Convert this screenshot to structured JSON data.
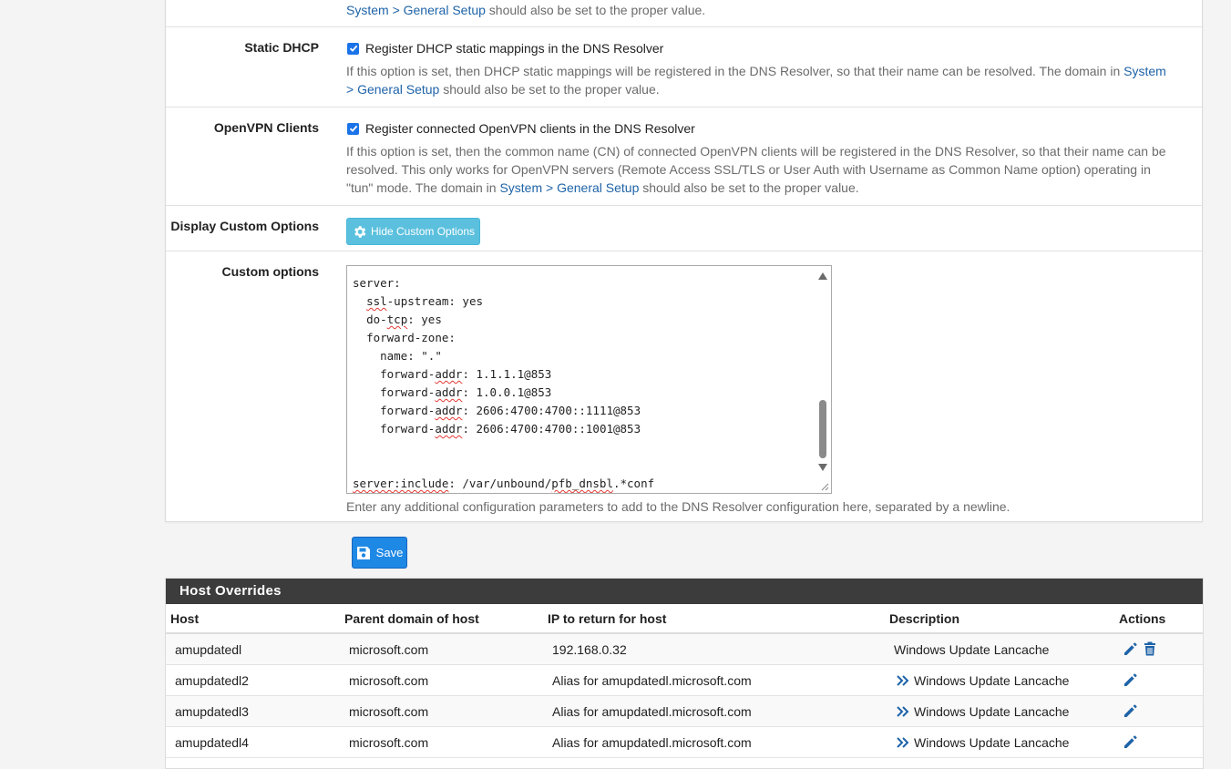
{
  "sections": {
    "top_note": {
      "link": "System > General Setup",
      "text": " should also be set to the proper value."
    },
    "static_dhcp": {
      "label": "Static DHCP",
      "checkbox_label": "Register DHCP static mappings in the DNS Resolver",
      "checked": true,
      "help_prefix": "If this option is set, then DHCP static mappings will be registered in the DNS Resolver, so that their name can be resolved. The domain in ",
      "help_link": "System > General Setup",
      "help_suffix": " should also be set to the proper value."
    },
    "openvpn_clients": {
      "label": "OpenVPN Clients",
      "checkbox_label": "Register connected OpenVPN clients in the DNS Resolver",
      "checked": true,
      "help_prefix": "If this option is set, then the common name (CN) of connected OpenVPN clients will be registered in the DNS Resolver, so that their name can be resolved. This only works for OpenVPN servers (Remote Access SSL/TLS or User Auth with Username as Common Name option) operating in \"tun\" mode. The domain in ",
      "help_link": "System > General Setup",
      "help_suffix": " should also be set to the proper value."
    },
    "display_custom": {
      "label": "Display Custom Options",
      "button_label": "Hide Custom Options",
      "button_icon": "gear-icon"
    },
    "custom_options": {
      "label": "Custom options",
      "help": "Enter any additional configuration parameters to add to the DNS Resolver configuration here, separated by a newline."
    }
  },
  "code": {
    "l1": "server:",
    "l2a": "ssl",
    "l2b": "-upstream: yes",
    "l3a": "do-",
    "l3b": "tcp",
    "l3c": ": yes",
    "l4": "forward-zone:",
    "l5": "name: \".\"",
    "l6a": "forward-",
    "l6b": "addr",
    "l6c": ": 1.1.1.1@853",
    "l7a": "forward-",
    "l7b": "addr",
    "l7c": ": 1.0.0.1@853",
    "l8a": "forward-",
    "l8b": "addr",
    "l8c": ": 2606:4700:4700::1111@853",
    "l9a": "forward-",
    "l9b": "addr",
    "l9c": ": 2606:4700:4700::1001@853",
    "l10a": "server:include",
    "l10b": ": /var/unbound/",
    "l10c": "pfb_dnsbl",
    "l10d": ".*conf"
  },
  "save": {
    "label": "Save",
    "icon": "floppy-disk-icon"
  },
  "host_overrides": {
    "title": "Host Overrides",
    "columns": [
      "Host",
      "Parent domain of host",
      "IP to return for host",
      "Description",
      "Actions"
    ],
    "rows": [
      {
        "host": "amupdatedl",
        "domain": "microsoft.com",
        "ip": "192.168.0.32",
        "description": "Windows Update Lancache",
        "alias": false,
        "actions": [
          "edit-icon",
          "delete-icon"
        ]
      },
      {
        "host": "amupdatedl2",
        "domain": "microsoft.com",
        "ip": "Alias for amupdatedl.microsoft.com",
        "description": "Windows Update Lancache",
        "alias": true,
        "actions": [
          "edit-icon"
        ]
      },
      {
        "host": "amupdatedl3",
        "domain": "microsoft.com",
        "ip": "Alias for amupdatedl.microsoft.com",
        "description": "Windows Update Lancache",
        "alias": true,
        "actions": [
          "edit-icon"
        ]
      },
      {
        "host": "amupdatedl4",
        "domain": "microsoft.com",
        "ip": "Alias for amupdatedl.microsoft.com",
        "description": "Windows Update Lancache",
        "alias": true,
        "actions": [
          "edit-icon"
        ]
      }
    ]
  },
  "colors": {
    "link": "#1e63a8",
    "checkbox": "#1a73e8",
    "info_button": "#5bc0de",
    "save_button": "#1e88e5",
    "table_header": "#3c3c3c",
    "spell_error": "#e53935"
  }
}
